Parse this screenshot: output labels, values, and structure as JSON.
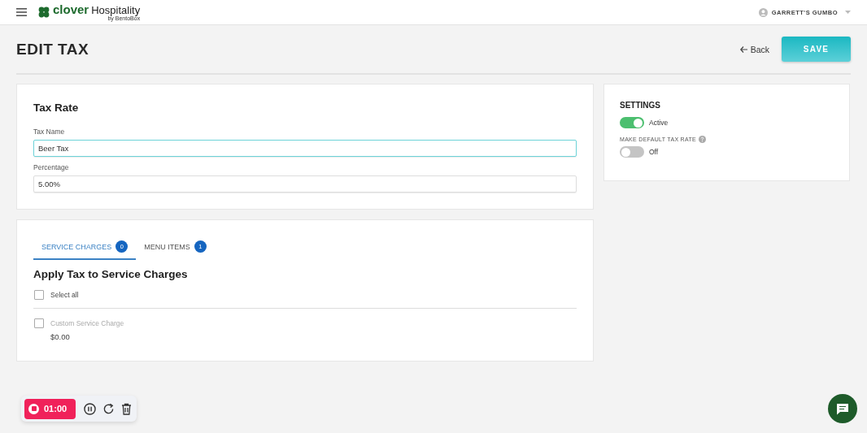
{
  "header": {
    "brand": "clover",
    "brand_suffix": "Hospitality",
    "tagline": "by BentoBox",
    "account": "GARRETT'S GUMBO"
  },
  "page": {
    "title": "EDIT TAX",
    "back": "Back",
    "save": "SAVE"
  },
  "tax_rate": {
    "title": "Tax Rate",
    "fields": [
      {
        "label": "Tax Name",
        "value": "Beer Tax",
        "focused": true
      },
      {
        "label": "Percentage",
        "value": "5.00%",
        "focused": false
      }
    ]
  },
  "settings": {
    "title": "SETTINGS",
    "toggles": [
      {
        "label": "Active",
        "on": true
      },
      {
        "heading": "MAKE DEFAULT TAX RATE",
        "label": "Off",
        "on": false
      }
    ]
  },
  "tabs": [
    {
      "label": "SERVICE CHARGES",
      "count": "0",
      "selected": true
    },
    {
      "label": "MENU ITEMS",
      "count": "1",
      "selected": false
    }
  ],
  "apply": {
    "title": "Apply Tax to Service Charges",
    "select_all": {
      "label": "Select all",
      "checked": false
    },
    "items": [
      {
        "name": "Custom Service Charge",
        "price": "$0.00",
        "checked": false,
        "disabled": true
      }
    ]
  },
  "recorder": {
    "time": "01:00"
  }
}
